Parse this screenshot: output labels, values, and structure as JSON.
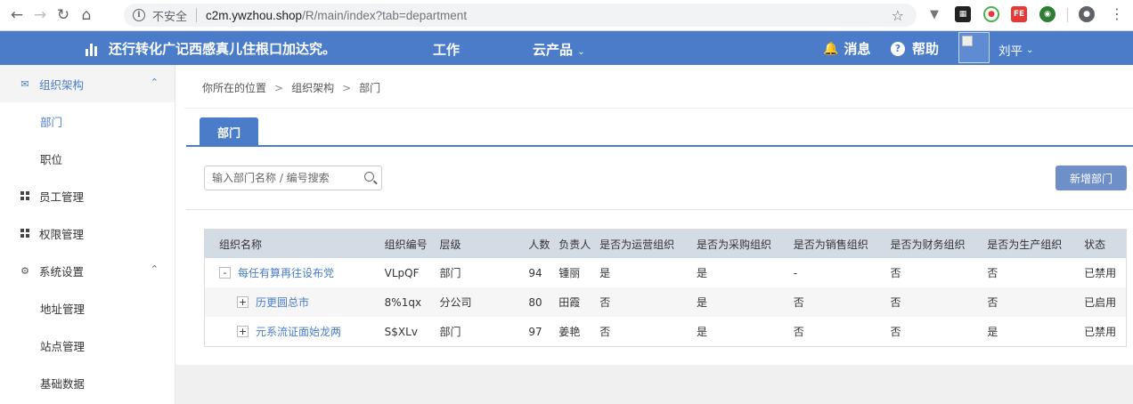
{
  "browser": {
    "security_label": "不安全",
    "url_host": "c2m.ywzhou.shop",
    "url_path": "/R/main/index?tab=department"
  },
  "header": {
    "brand": "还行转化广记西感真儿住根口加达究。",
    "nav": [
      {
        "label": "工作",
        "has_dropdown": false
      },
      {
        "label": "云产品",
        "has_dropdown": true
      }
    ],
    "messages_label": "消息",
    "help_label": "帮助",
    "user_name": "刘平",
    "accent_color": "#4a7cc9"
  },
  "sidebar": {
    "items": [
      {
        "label": "组织架构",
        "icon": "mail-icon",
        "expanded": true,
        "active": true
      },
      {
        "label": "部门",
        "sub": true,
        "selected": true
      },
      {
        "label": "职位",
        "sub": true
      },
      {
        "label": "员工管理",
        "icon": "grid-icon"
      },
      {
        "label": "权限管理",
        "icon": "grid-icon"
      },
      {
        "label": "系统设置",
        "icon": "gear-icon",
        "expanded": true
      },
      {
        "label": "地址管理",
        "sub": true
      },
      {
        "label": "站点管理",
        "sub": true
      },
      {
        "label": "基础数据",
        "sub": true
      }
    ]
  },
  "breadcrumb": {
    "prefix": "你所在的位置",
    "items": [
      "组织架构",
      "部门"
    ],
    "separator": ">"
  },
  "tab": {
    "label": "部门"
  },
  "search": {
    "placeholder": "输入部门名称 / 编号搜索"
  },
  "add_button": {
    "label": "新增部门"
  },
  "table": {
    "columns": [
      "组织名称",
      "组织编号",
      "层级",
      "人数",
      "负责人",
      "是否为运营组织",
      "是否为采购组织",
      "是否为销售组织",
      "是否为财务组织",
      "是否为生产组织",
      "状态"
    ],
    "rows": [
      {
        "toggle": "-",
        "level": 0,
        "name": "每任有算再往设布党",
        "code": "VLpQF",
        "tier": "部门",
        "count": "94",
        "owner": "锺丽",
        "ops": "是",
        "purchase": "是",
        "sales": "-",
        "finance": "否",
        "production": "否",
        "status": "已禁用"
      },
      {
        "toggle": "+",
        "level": 1,
        "name": "历更圆总市",
        "code": "8%1qx",
        "tier": "分公司",
        "count": "80",
        "owner": "田霞",
        "ops": "否",
        "purchase": "是",
        "sales": "否",
        "finance": "否",
        "production": "否",
        "status": "已启用"
      },
      {
        "toggle": "+",
        "level": 1,
        "name": "元系流证面始龙两",
        "code": "S$XLv",
        "tier": "部门",
        "count": "97",
        "owner": "姜艳",
        "ops": "否",
        "purchase": "是",
        "sales": "否",
        "finance": "否",
        "production": "是",
        "status": "已禁用"
      }
    ]
  }
}
